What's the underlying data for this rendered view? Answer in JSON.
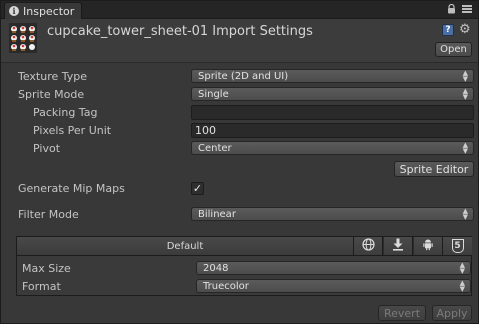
{
  "window": {
    "tab_title": "Inspector",
    "tab_icon": "info-icon"
  },
  "header": {
    "asset_title": "cupcake_tower_sheet-01 Import Settings",
    "open_label": "Open",
    "thumbnail": "sprite-sheet-thumbnail"
  },
  "properties": {
    "texture_type_label": "Texture Type",
    "texture_type_value": "Sprite (2D and UI)",
    "sprite_mode_label": "Sprite Mode",
    "sprite_mode_value": "Single",
    "packing_tag_label": "Packing Tag",
    "packing_tag_value": "",
    "pixels_per_unit_label": "Pixels Per Unit",
    "pixels_per_unit_value": "100",
    "pivot_label": "Pivot",
    "pivot_value": "Center",
    "sprite_editor_label": "Sprite Editor",
    "generate_mip_maps_label": "Generate Mip Maps",
    "generate_mip_maps_checked": true,
    "check_mark": "✓",
    "filter_mode_label": "Filter Mode",
    "filter_mode_value": "Bilinear"
  },
  "platform": {
    "default_tab": "Default",
    "tabs": [
      "web-globe-icon",
      "download-standalone-icon",
      "android-icon",
      "html5-icon"
    ],
    "html5_label": "5",
    "max_size_label": "Max Size",
    "max_size_value": "2048",
    "format_label": "Format",
    "format_value": "Truecolor"
  },
  "footer": {
    "revert_label": "Revert",
    "apply_label": "Apply"
  },
  "colors": {
    "panel_bg": "#383838",
    "header_bg": "#3c3c3c",
    "help_blue": "#4a6fa5"
  }
}
